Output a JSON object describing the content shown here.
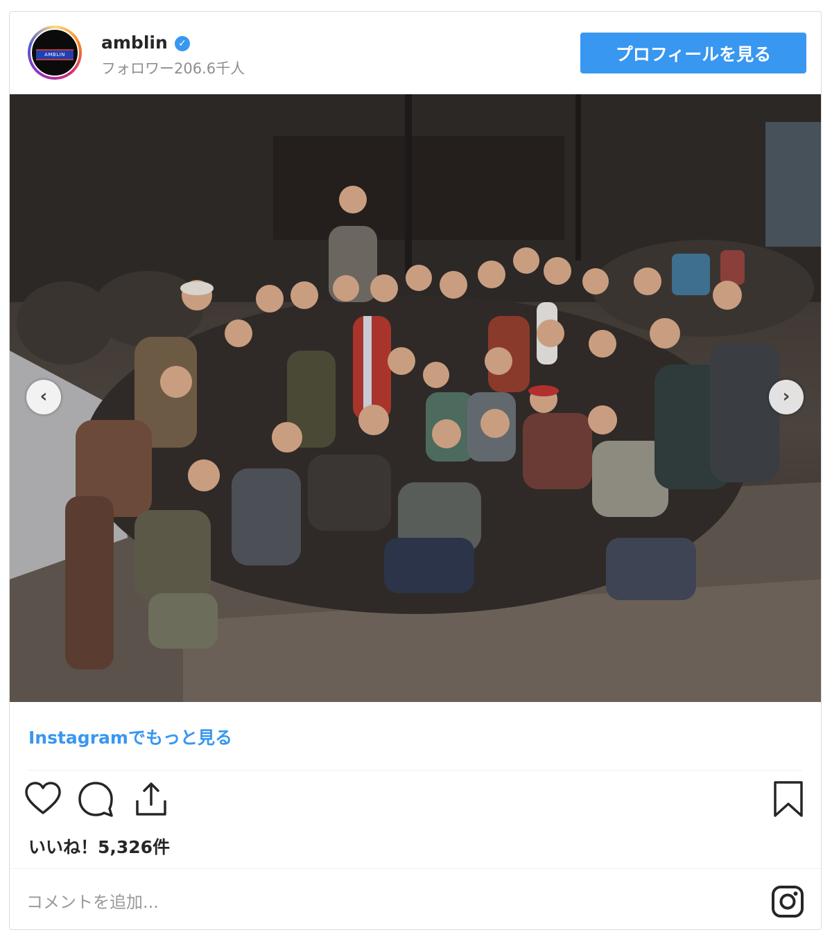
{
  "header": {
    "username": "amblin",
    "verified_mark": "✓",
    "followers": "フォロワー206.6千人",
    "avatar_text": "AMBLIN",
    "profile_button": "プロフィールを見る"
  },
  "post": {
    "carousel_prev": "‹",
    "carousel_next": "›"
  },
  "footer": {
    "more_link": "Instagramでもっと見る",
    "likes": "いいね！5,326件",
    "comment_placeholder": "コメントを追加..."
  },
  "colors": {
    "accent": "#3897f0",
    "text": "#262626",
    "muted": "#8e8e8e"
  },
  "icons": [
    "heart-icon",
    "comment-icon",
    "share-icon",
    "bookmark-icon",
    "instagram-logo-icon",
    "verified-badge-icon"
  ]
}
